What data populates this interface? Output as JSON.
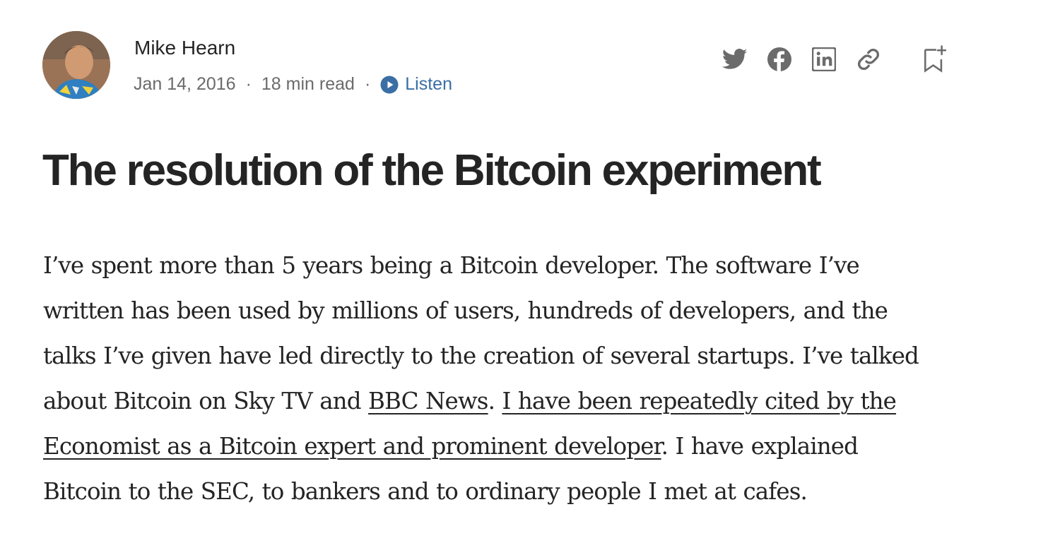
{
  "author": {
    "name": "Mike Hearn",
    "date": "Jan 14, 2016",
    "separator": "·",
    "read_time": "18 min read",
    "listen_label": "Listen"
  },
  "share_icons": [
    "twitter-icon",
    "facebook-icon",
    "linkedin-icon",
    "link-icon",
    "bookmark-add-icon"
  ],
  "article": {
    "title": "The resolution of the Bitcoin experiment",
    "lines": [
      "I’ve spent more than 5 years being a Bitcoin developer. The software I’ve",
      "written has been used by millions of users, hundreds of developers, and the",
      "talks I’ve given have led directly to the creation of several startups. I’ve talked"
    ],
    "line4_prefix": "about Bitcoin on Sky TV and ",
    "link_bbc": "BBC News",
    "line4_mid": ". ",
    "link_economist_part1": "I have been repeatedly cited by the",
    "link_economist_part2": "Economist as a Bitcoin expert and prominent developer",
    "line5_suffix": ". I have explained",
    "line6": "Bitcoin to the SEC, to bankers and to ordinary people I met at cafes."
  },
  "colors": {
    "text": "#242424",
    "muted": "#6b6b6b",
    "icon": "#6b6b6b",
    "listen_accent": "#3a6ea5"
  }
}
